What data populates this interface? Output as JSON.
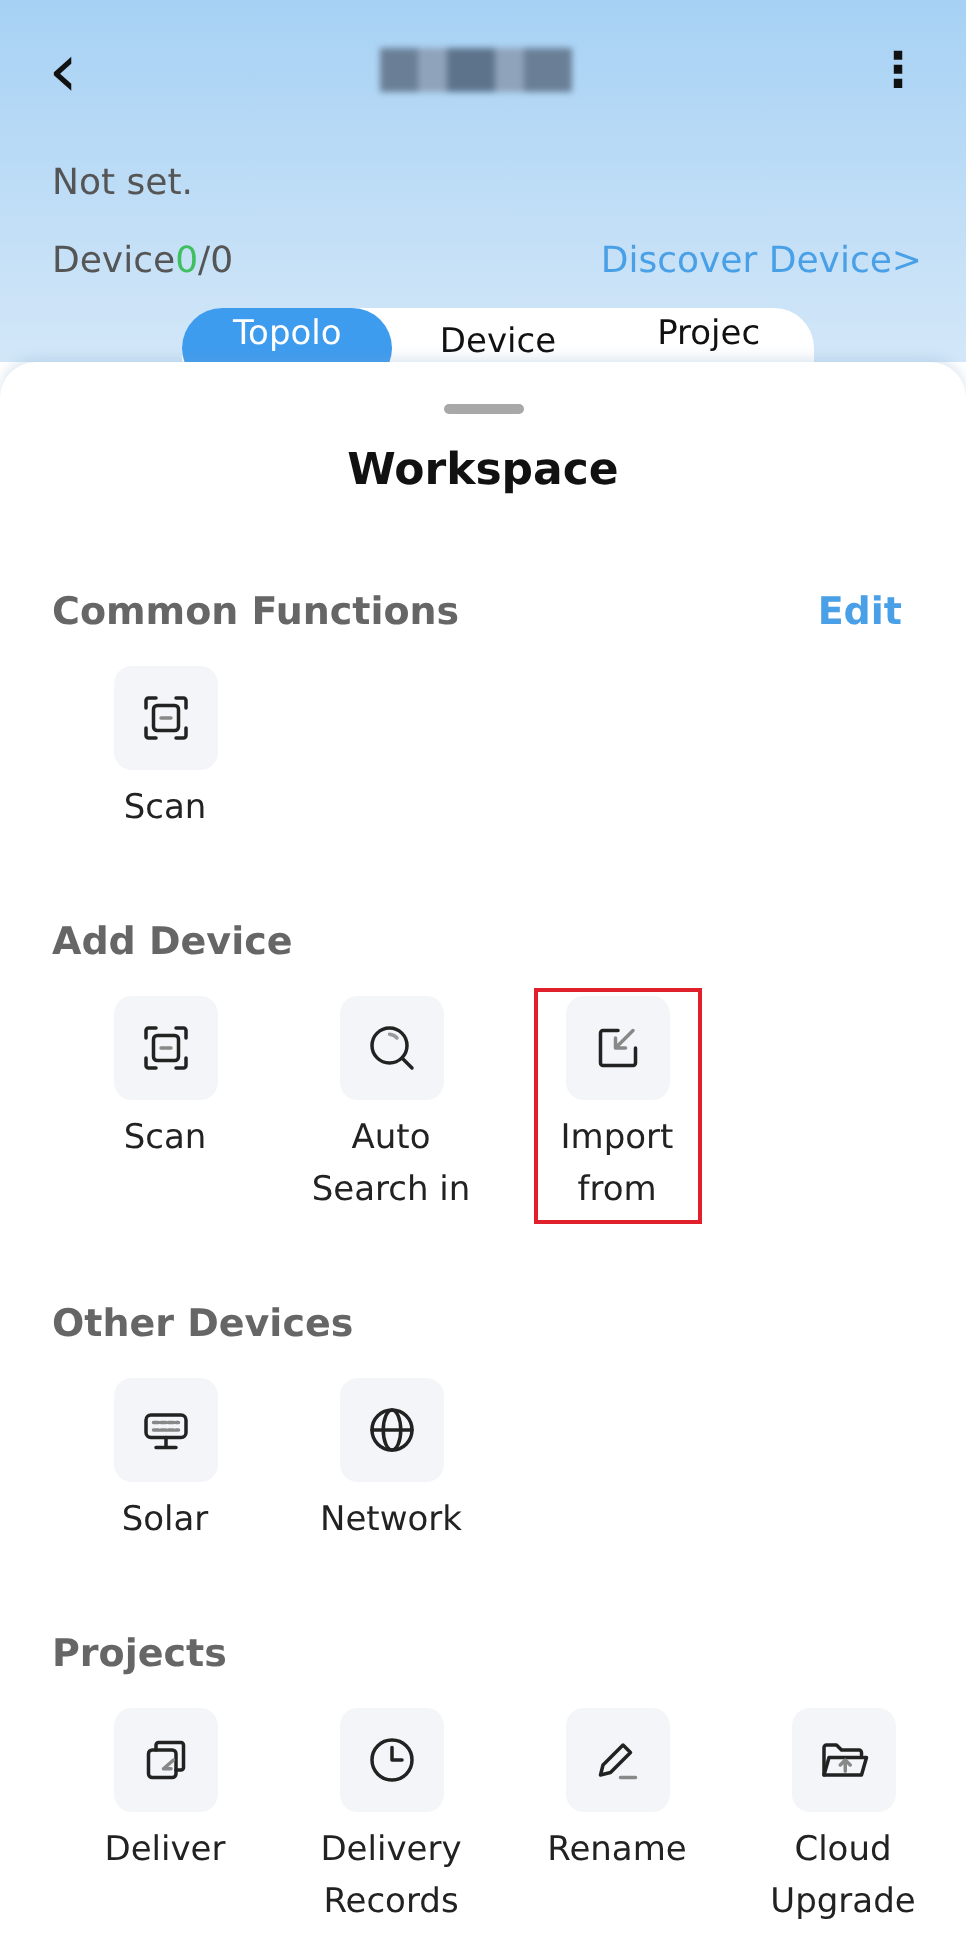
{
  "header": {
    "back": "‹",
    "more": "⋮",
    "status": "Not set.",
    "device_label": "Device",
    "device_online": "0",
    "device_total": "/0",
    "discover_link": "Discover Device>"
  },
  "tabs": [
    {
      "label": "Topolo",
      "selected": true
    },
    {
      "label": "Device",
      "selected": false
    },
    {
      "label": "Projec",
      "selected": false
    }
  ],
  "sheet": {
    "title": "Workspace"
  },
  "sections": [
    {
      "title": "Common Functions",
      "action": "Edit",
      "items": [
        {
          "kind": "scan",
          "label": "Scan",
          "highlighted": false
        }
      ]
    },
    {
      "title": "Add Device",
      "items": [
        {
          "kind": "scan",
          "label": "Scan",
          "highlighted": false
        },
        {
          "kind": "search",
          "label": "Auto Search in",
          "highlighted": false
        },
        {
          "kind": "import",
          "label": "Import from",
          "highlighted": true
        }
      ]
    },
    {
      "title": "Other Devices",
      "items": [
        {
          "kind": "solar",
          "label": "Solar",
          "highlighted": false
        },
        {
          "kind": "globe",
          "label": "Network",
          "highlighted": false
        }
      ]
    },
    {
      "title": "Projects",
      "items": [
        {
          "kind": "deliver",
          "label": "Deliver",
          "highlighted": false
        },
        {
          "kind": "clock",
          "label": "Delivery Records",
          "highlighted": false
        },
        {
          "kind": "pencil",
          "label": "Rename",
          "highlighted": false
        },
        {
          "kind": "folder",
          "label": "Cloud Upgrade",
          "highlighted": false
        }
      ]
    }
  ]
}
